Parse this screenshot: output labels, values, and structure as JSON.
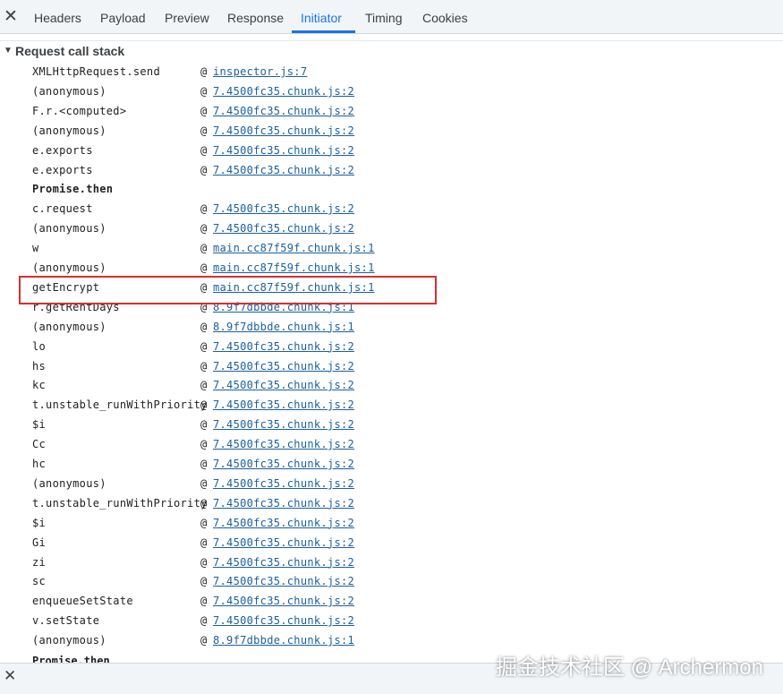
{
  "tabs": [
    "Headers",
    "Payload",
    "Preview",
    "Response",
    "Initiator",
    "Timing",
    "Cookies"
  ],
  "active_tab": "Initiator",
  "section_title": "Request call stack",
  "frames": [
    {
      "fn": "XMLHttpRequest.send",
      "link": "inspector.js:7"
    },
    {
      "fn": "(anonymous)",
      "link": "7.4500fc35.chunk.js:2"
    },
    {
      "fn": "F.r.<computed>",
      "link": "7.4500fc35.chunk.js:2"
    },
    {
      "fn": "(anonymous)",
      "link": "7.4500fc35.chunk.js:2"
    },
    {
      "fn": "e.exports",
      "link": "7.4500fc35.chunk.js:2"
    },
    {
      "fn": "e.exports",
      "link": "7.4500fc35.chunk.js:2"
    },
    {
      "async": "Promise.then"
    },
    {
      "fn": "c.request",
      "link": "7.4500fc35.chunk.js:2"
    },
    {
      "fn": "(anonymous)",
      "link": "7.4500fc35.chunk.js:2"
    },
    {
      "fn": "w",
      "link": "main.cc87f59f.chunk.js:1"
    },
    {
      "fn": "(anonymous)",
      "link": "main.cc87f59f.chunk.js:1"
    },
    {
      "fn": "getEncrypt",
      "link": "main.cc87f59f.chunk.js:1"
    },
    {
      "fn": "r.getRentDays",
      "link": "8.9f7dbbde.chunk.js:1"
    },
    {
      "fn": "(anonymous)",
      "link": "8.9f7dbbde.chunk.js:1"
    },
    {
      "fn": "lo",
      "link": "7.4500fc35.chunk.js:2"
    },
    {
      "fn": "hs",
      "link": "7.4500fc35.chunk.js:2"
    },
    {
      "fn": "kc",
      "link": "7.4500fc35.chunk.js:2"
    },
    {
      "fn": "t.unstable_runWithPriority",
      "link": "7.4500fc35.chunk.js:2"
    },
    {
      "fn": "$i",
      "link": "7.4500fc35.chunk.js:2"
    },
    {
      "fn": "Cc",
      "link": "7.4500fc35.chunk.js:2"
    },
    {
      "fn": "hc",
      "link": "7.4500fc35.chunk.js:2"
    },
    {
      "fn": "(anonymous)",
      "link": "7.4500fc35.chunk.js:2"
    },
    {
      "fn": "t.unstable_runWithPriority",
      "link": "7.4500fc35.chunk.js:2"
    },
    {
      "fn": "$i",
      "link": "7.4500fc35.chunk.js:2"
    },
    {
      "fn": "Gi",
      "link": "7.4500fc35.chunk.js:2"
    },
    {
      "fn": "zi",
      "link": "7.4500fc35.chunk.js:2"
    },
    {
      "fn": "sc",
      "link": "7.4500fc35.chunk.js:2"
    },
    {
      "fn": "enqueueSetState",
      "link": "7.4500fc35.chunk.js:2"
    },
    {
      "fn": "v.setState",
      "link": "7.4500fc35.chunk.js:2"
    },
    {
      "fn": "(anonymous)",
      "link": "8.9f7dbbde.chunk.js:1"
    }
  ],
  "trailing_partial_label": "Promise.then",
  "highlighted_frame": "getEncrypt",
  "at_symbol": "@",
  "watermark": "掘金技术社区 @ Archermon",
  "colors": {
    "accent": "#1a73e8",
    "link": "#1a5f9e",
    "highlight": "#d92f2f"
  }
}
